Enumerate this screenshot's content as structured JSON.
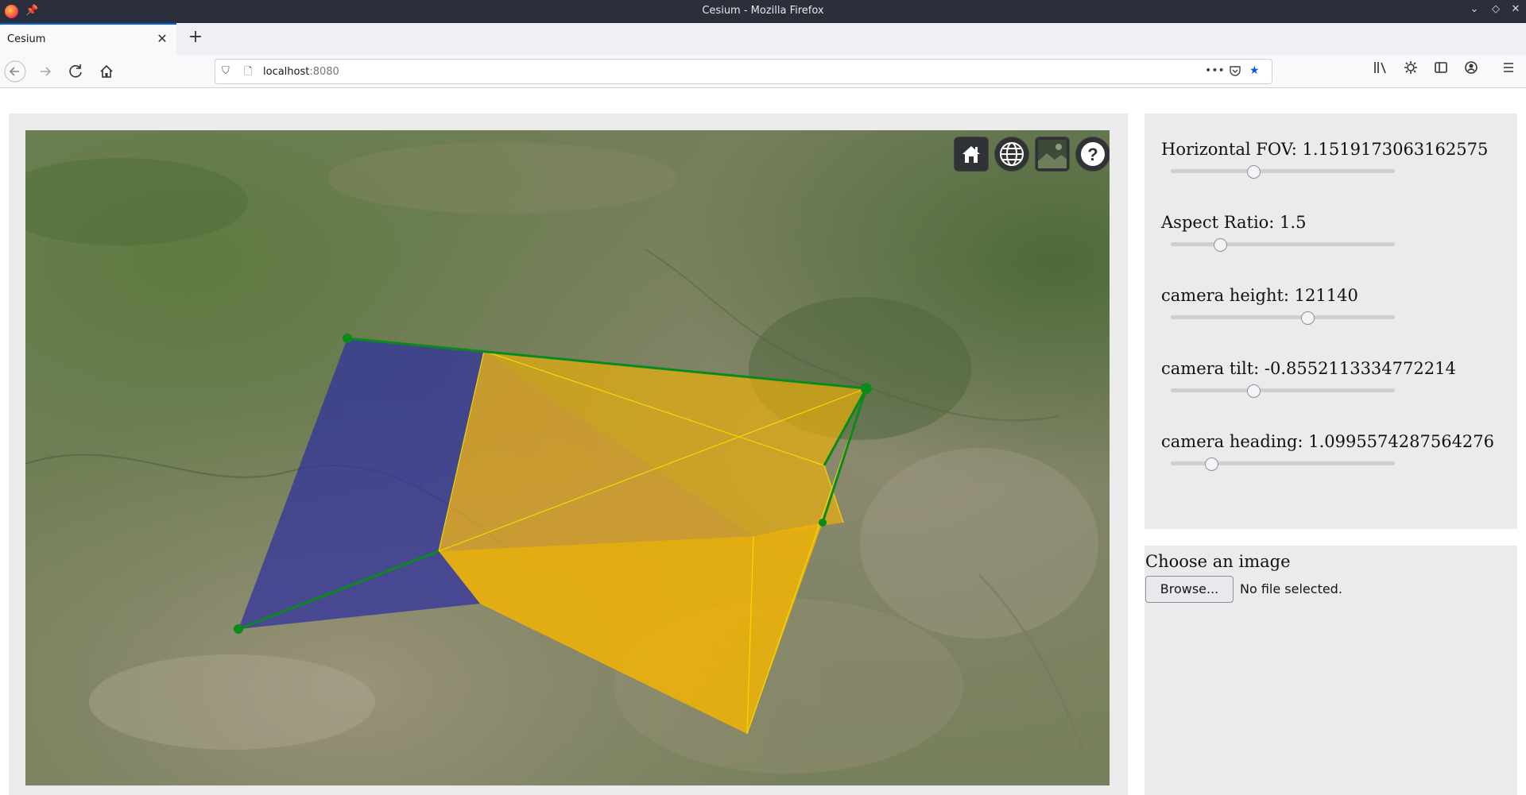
{
  "window": {
    "title": "Cesium - Mozilla Firefox"
  },
  "tab": {
    "label": "Cesium",
    "close_glyph": "✕",
    "new_tab_glyph": "+"
  },
  "navbar": {
    "url_host": "localhost",
    "url_port": ":8080"
  },
  "viewer": {
    "buttons": [
      "home-icon",
      "globe-icon",
      "imagery-icon",
      "help-icon"
    ],
    "colors": {
      "footprint_blue": "#2e2fa0",
      "footprint_yellow": "#f7b400",
      "frustum_green": "#0b8a1c"
    }
  },
  "controls": [
    {
      "label": "Horizontal FOV: 1.1519173063162575",
      "fraction": 0.37
    },
    {
      "label": "Aspect Ratio: 1.5",
      "fraction": 0.22
    },
    {
      "label": "camera height: 121140",
      "fraction": 0.61
    },
    {
      "label": "camera tilt: -0.8552113334772214",
      "fraction": 0.37
    },
    {
      "label": "camera heading: 1.0995574287564276",
      "fraction": 0.18
    }
  ],
  "file_input": {
    "label": "Choose an image",
    "button": "Browse...",
    "status": "No file selected."
  }
}
